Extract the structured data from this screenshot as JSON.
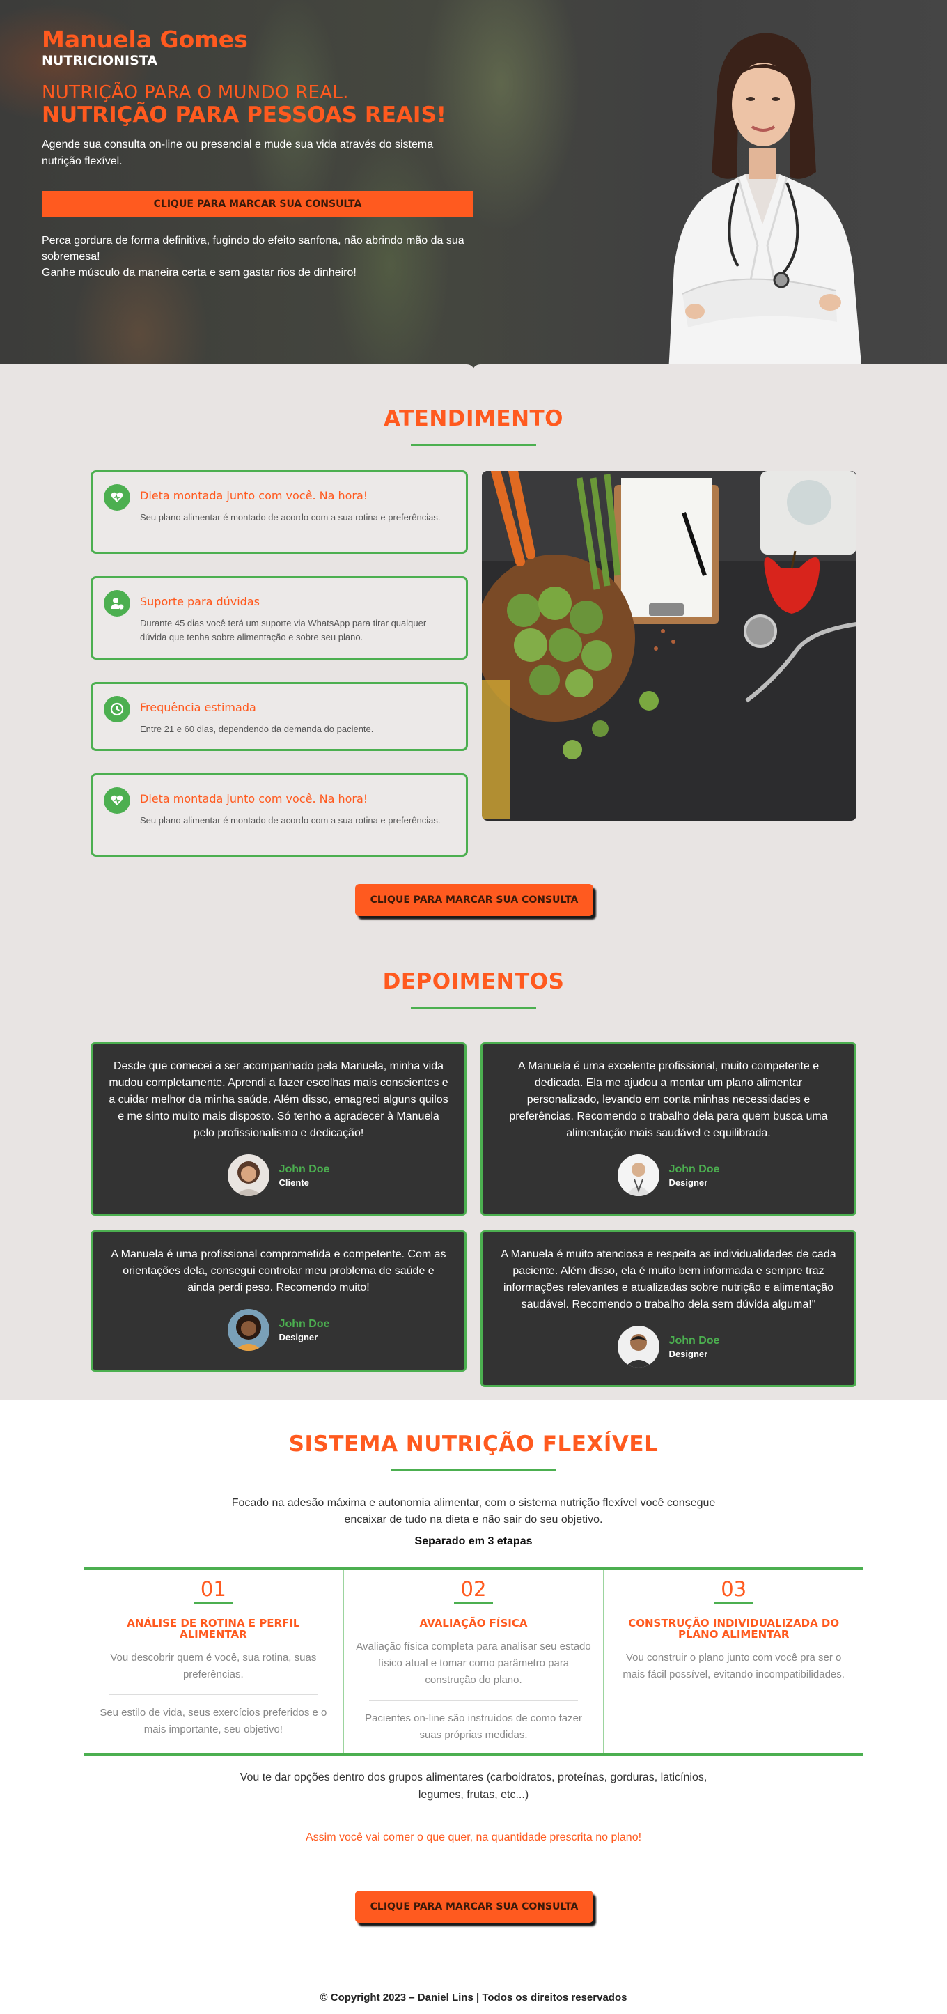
{
  "hero": {
    "name": "Manuela Gomes",
    "role": "NUTRICIONISTA",
    "tagline_1": "NUTRIÇÃO PARA O MUNDO REAL.",
    "tagline_2": "NUTRIÇÃO PARA PESSOAS REAIS!",
    "lead": "Agende sua consulta on-line ou presencial e mude sua vida através do sistema nutrição flexível.",
    "cta_label": "CLIQUE PARA MARCAR SUA CONSULTA",
    "sub_1": "Perca gordura de forma definitiva, fugindo do efeito sanfona, não abrindo mão da sua sobremesa!",
    "sub_2": "Ganhe músculo da maneira certa e sem gastar rios de dinheiro!"
  },
  "atendimento": {
    "title": "ATENDIMENTO",
    "cards": [
      {
        "icon": "heart-icon",
        "title": "Dieta montada junto com você. Na hora!",
        "text": "Seu plano alimentar é montado de acordo com a sua rotina e preferências."
      },
      {
        "icon": "user-support-icon",
        "title": "Suporte para dúvidas",
        "text": "Durante 45 dias você terá um suporte via WhatsApp para tirar qualquer dúvida que tenha sobre alimentação e sobre seu plano."
      },
      {
        "icon": "clock-icon",
        "title": "Frequência estimada",
        "text": "Entre 21 e 60 dias, dependendo da demanda do paciente."
      },
      {
        "icon": "heart-icon",
        "title": "Dieta montada junto com você. Na hora!",
        "text": "Seu plano alimentar é montado de acordo com a sua rotina e preferências."
      }
    ],
    "cta_label": "CLIQUE PARA MARCAR SUA CONSULTA"
  },
  "depoimentos": {
    "title": "DEPOIMENTOS",
    "items": [
      {
        "text": "Desde que comecei a ser acompanhado pela Manuela, minha vida mudou completamente. Aprendi a fazer escolhas mais conscientes e a cuidar melhor da minha saúde. Além disso, emagreci alguns quilos e me sinto muito mais disposto. Só tenho a agradecer à Manuela pelo profissionalismo e dedicação!",
        "name": "John Doe",
        "role": "Cliente"
      },
      {
        "text": "A Manuela é uma excelente profissional, muito competente e dedicada. Ela me ajudou a montar um plano alimentar personalizado, levando em conta minhas necessidades e preferências. Recomendo o trabalho dela para quem busca uma alimentação mais saudável e equilibrada.",
        "name": "John Doe",
        "role": "Designer"
      },
      {
        "text": "A Manuela é uma profissional comprometida e competente. Com as orientações dela, consegui controlar meu problema de saúde e ainda perdi peso. Recomendo muito!",
        "name": "John Doe",
        "role": "Designer"
      },
      {
        "text": "A Manuela é muito atenciosa e respeita as individualidades de cada paciente. Além disso, ela é muito bem informada e sempre traz informações relevantes e atualizadas sobre nutrição e alimentação saudável. Recomendo o trabalho dela sem dúvida alguma!\"",
        "name": "John Doe",
        "role": "Designer"
      }
    ]
  },
  "sistema": {
    "title": "SISTEMA NUTRIÇÃO FLEXÍVEL",
    "desc": "Focado na adesão máxima e autonomia alimentar, com o sistema nutrição flexível você consegue encaixar de tudo na dieta e não sair do seu objetivo.",
    "separator": "Separado em 3 etapas",
    "steps": [
      {
        "num": "01",
        "title": "ANÁLISE DE ROTINA E PERFIL ALIMENTAR",
        "p1": "Vou descobrir quem é você, sua rotina, suas preferências.",
        "p2": "Seu estilo de vida, seus exercícios preferidos e o mais importante, seu objetivo!"
      },
      {
        "num": "02",
        "title": "AVALIAÇÃO FÍSICA",
        "p1": "Avaliação física completa para analisar seu estado físico atual e tomar como parâmetro para construção do plano.",
        "p2": "Pacientes on-line são instruídos de como fazer suas próprias medidas."
      },
      {
        "num": "03",
        "title": "CONSTRUÇÃO INDIVIDUALIZADA DO PLANO ALIMENTAR",
        "p1": "Vou construir o plano junto com você pra ser o mais fácil possível, evitando incompatibilidades.",
        "p2": ""
      }
    ],
    "note": "Vou te dar opções dentro dos grupos alimentares (carboidratos, proteínas, gorduras, laticínios, legumes, frutas, etc...)",
    "accent": "Assim você vai comer o que quer, na quantidade prescrita no plano!",
    "cta_label": "CLIQUE PARA MARCAR SUA CONSULTA"
  },
  "footer": {
    "copyright": "© Copyright 2023 – Daniel Lins | Todos os direitos reservados"
  },
  "colors": {
    "accent": "#ff5a1f",
    "green": "#4caf50",
    "dark": "#333333",
    "gray_bg": "#e8e4e3"
  }
}
